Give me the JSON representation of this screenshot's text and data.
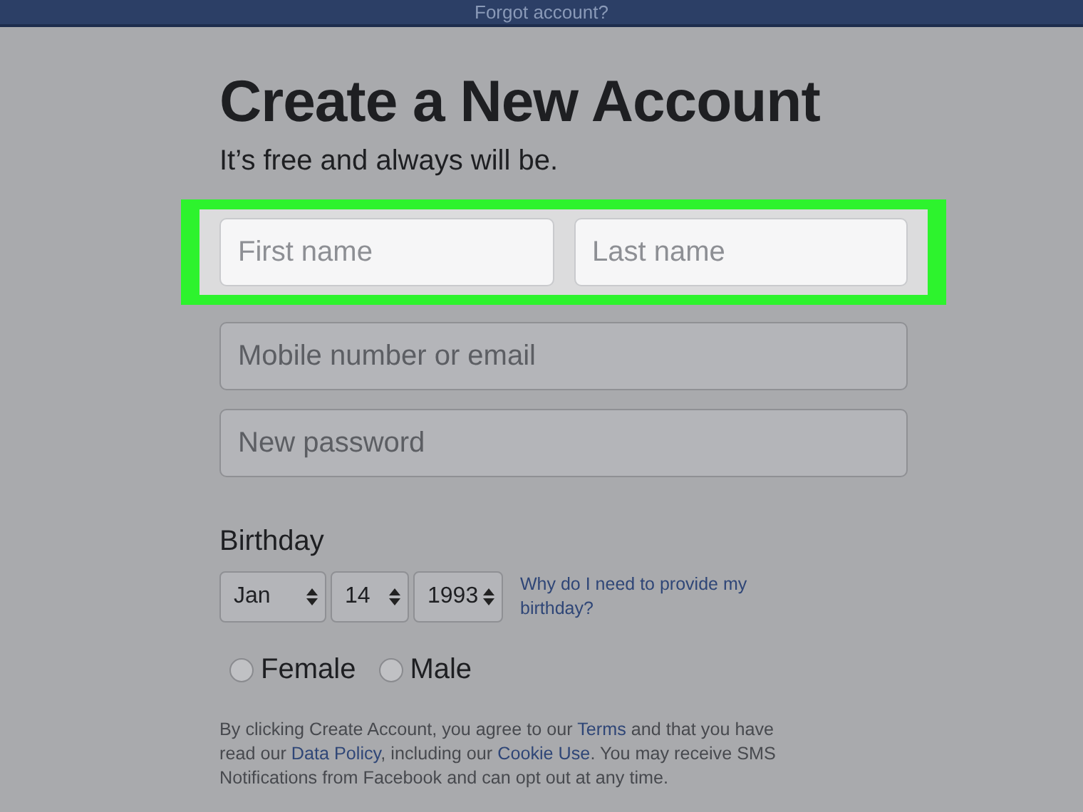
{
  "top_bar": {
    "link": "Forgot account?"
  },
  "title": "Create a New Account",
  "subtitle": "It’s free and always will be.",
  "name_fields": {
    "highlighted": true,
    "fields": [
      {
        "placeholder": "First name"
      },
      {
        "placeholder": "Last name"
      }
    ]
  },
  "fields": [
    {
      "placeholder": "Mobile number or email"
    },
    {
      "placeholder": "New password"
    }
  ],
  "birthday": {
    "label": "Birthday",
    "selects": [
      {
        "value": "Jan"
      },
      {
        "value": "14"
      },
      {
        "value": "1993"
      }
    ],
    "help_link": "Why do I need to provide my birthday?"
  },
  "gender": [
    {
      "label": "Female",
      "selected": false
    },
    {
      "label": "Male",
      "selected": false
    }
  ],
  "terms": [
    {
      "kind": "text",
      "text": "By clicking Create Account, you agree to our "
    },
    {
      "kind": "link",
      "text": "Terms"
    },
    {
      "kind": "text",
      "text": " and that you have read our "
    },
    {
      "kind": "link",
      "text": "Data Policy"
    },
    {
      "kind": "text",
      "text": ", including our "
    },
    {
      "kind": "link",
      "text": "Cookie Use"
    },
    {
      "kind": "text",
      "text": ". You may receive SMS Notifications from Facebook and can opt out at any time."
    }
  ]
}
